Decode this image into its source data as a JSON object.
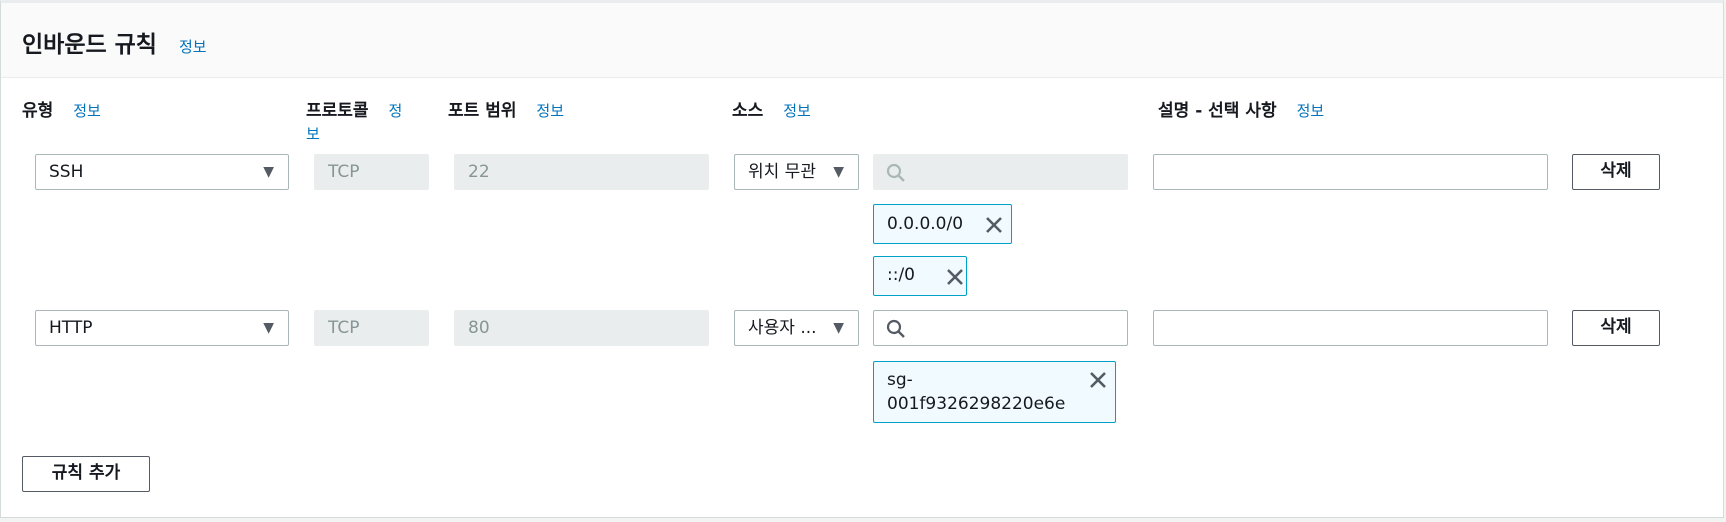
{
  "header": {
    "title": "인바운드 규칙",
    "info": "정보"
  },
  "columns": {
    "type": {
      "label": "유형",
      "info": "정보"
    },
    "protocol": {
      "label": "프로토콜",
      "info_line1": "정",
      "info_line2": "보"
    },
    "port": {
      "label": "포트 범위",
      "info": "정보"
    },
    "source": {
      "label": "소스",
      "info": "정보"
    },
    "desc": {
      "label": "설명 - 선택 사항",
      "info": "정보"
    }
  },
  "rules": [
    {
      "type": "SSH",
      "protocol": "TCP",
      "port": "22",
      "source_mode": "위치 무관",
      "search_value": "",
      "chips": [
        "0.0.0.0/0",
        "::/0"
      ],
      "description": "",
      "delete": "삭제"
    },
    {
      "type": "HTTP",
      "protocol": "TCP",
      "port": "80",
      "source_mode": "사용자 ...",
      "search_value": "",
      "chips": [
        "sg-001f9326298220e6e"
      ],
      "chip_lines": [
        "sg-",
        "001f9326298220e6e"
      ],
      "description": "",
      "delete": "삭제"
    }
  ],
  "add_rule": "규칙 추가",
  "icons": {
    "search": "search-icon",
    "remove": "close-icon",
    "dropdown": "caret-down-icon"
  }
}
